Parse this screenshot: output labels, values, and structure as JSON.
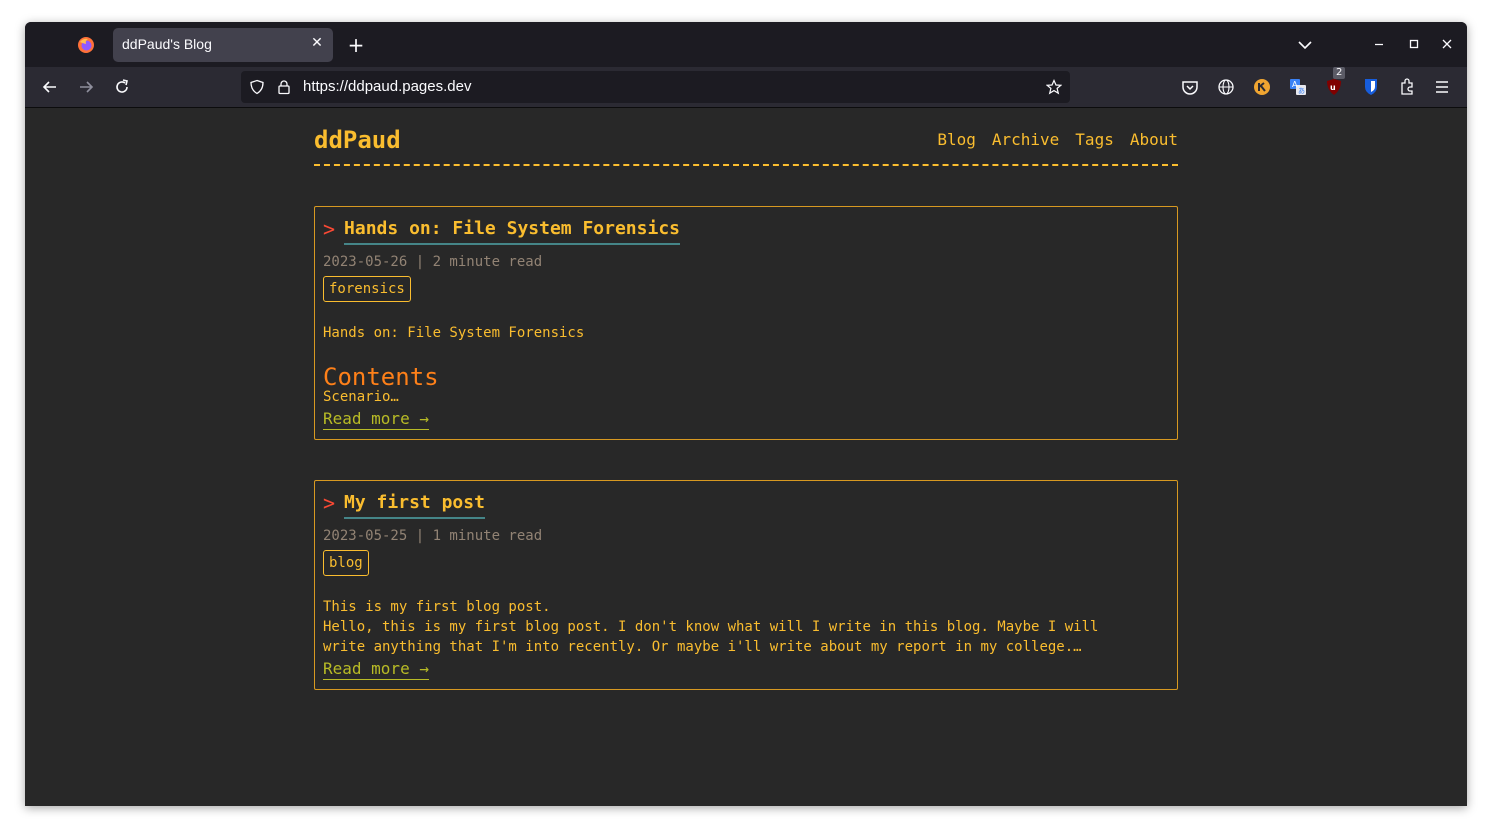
{
  "browser": {
    "tab_title": "ddPaud's Blog",
    "url": "https://ddpaud.pages.dev",
    "extension_badge": "2"
  },
  "site": {
    "logo": "ddPaud",
    "menu": [
      "Blog",
      "Archive",
      "Tags",
      "About"
    ]
  },
  "posts": [
    {
      "title": "Hands on: File System Forensics",
      "meta": "2023-05-26 | 2 minute read",
      "tag": "forensics",
      "summary_line1": "Hands on: File System Forensics",
      "heading": "Contents",
      "excerpt": "Scenario…",
      "read_more": "Read more →"
    },
    {
      "title": "My first post",
      "meta": "2023-05-25 | 1 minute read",
      "tag": "blog",
      "summary_line1": "This is my first blog post.",
      "summary_line2": "Hello, this is my first blog post. I don't know what will I write in this blog. Maybe I will",
      "summary_line3": "write anything that I'm into recently. Or maybe i'll write about my report in my college.…",
      "read_more": "Read more →"
    }
  ],
  "colors": {
    "page_bg": "#282828",
    "accent_yellow": "#fabd2f",
    "title_arrow_red": "#fb4934",
    "heading_orange": "#fe8019",
    "link_green": "#b8bb26",
    "underline_teal": "#458588",
    "meta_gray": "#928374"
  }
}
